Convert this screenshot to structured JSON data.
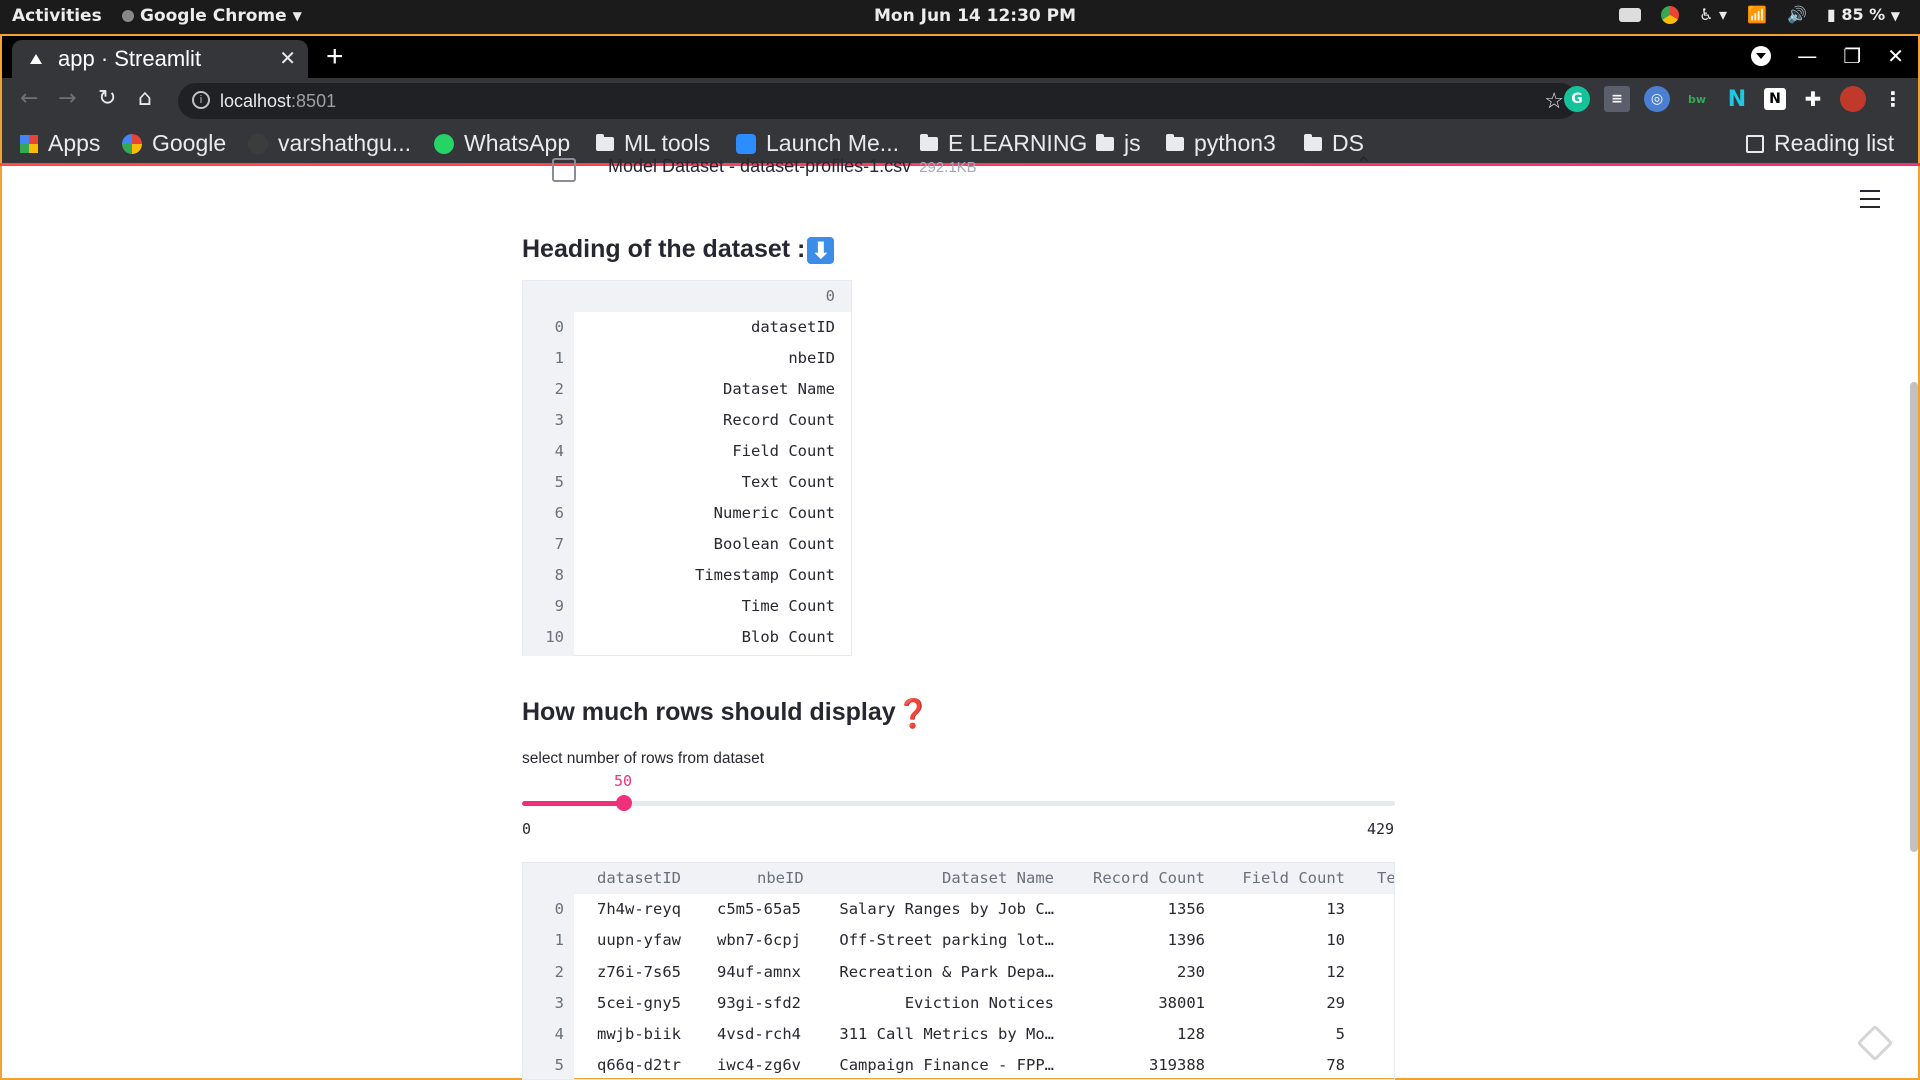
{
  "system_bar": {
    "activities": "Activities",
    "app_menu": "Google Chrome",
    "clock": "Mon Jun 14  12:30 PM",
    "battery": "85 %"
  },
  "browser": {
    "tab_title": "app · Streamlit",
    "url_host": "localhost",
    "url_port": ":8501",
    "bookmarks": [
      "Apps",
      "Google",
      "varshathgu...",
      "WhatsApp",
      "ML tools",
      "Launch Me...",
      "E LEARNING",
      "js",
      "python3",
      "DS"
    ],
    "reading_list": "Reading list"
  },
  "uploader": {
    "file_name": "Model Dataset - dataset-profiles-1.csv",
    "file_size": "292.1KB"
  },
  "heading_section": {
    "title": "Heading of the dataset :",
    "column_header": "0",
    "rows": [
      {
        "i": "0",
        "v": "datasetID"
      },
      {
        "i": "1",
        "v": "nbeID"
      },
      {
        "i": "2",
        "v": "Dataset Name"
      },
      {
        "i": "3",
        "v": "Record Count"
      },
      {
        "i": "4",
        "v": "Field Count"
      },
      {
        "i": "5",
        "v": "Text Count"
      },
      {
        "i": "6",
        "v": "Numeric Count"
      },
      {
        "i": "7",
        "v": "Boolean Count"
      },
      {
        "i": "8",
        "v": "Timestamp Count"
      },
      {
        "i": "9",
        "v": "Time Count"
      },
      {
        "i": "10",
        "v": "Blob Count"
      }
    ]
  },
  "rows_section": {
    "title": "How much rows should display",
    "slider_label": "select number of rows from dataset",
    "slider_value": 50,
    "slider_value_text": "50",
    "slider_min": "0",
    "slider_max": "429",
    "table": {
      "headers": [
        "datasetID",
        "nbeID",
        "Dataset Name",
        "Record Count",
        "Field Count",
        "Te"
      ],
      "rows": [
        {
          "i": "0",
          "datasetID": "7h4w-reyq",
          "nbeID": "c5m5-65a5",
          "name": "Salary Ranges by Job C…",
          "records": "1356",
          "fields": "13"
        },
        {
          "i": "1",
          "datasetID": "uupn-yfaw",
          "nbeID": "wbn7-6cpj",
          "name": "Off-Street parking lot…",
          "records": "1396",
          "fields": "10"
        },
        {
          "i": "2",
          "datasetID": "z76i-7s65",
          "nbeID": "94uf-amnx",
          "name": "Recreation & Park Depa…",
          "records": "230",
          "fields": "12"
        },
        {
          "i": "3",
          "datasetID": "5cei-gny5",
          "nbeID": "93gi-sfd2",
          "name": "Eviction Notices",
          "records": "38001",
          "fields": "29"
        },
        {
          "i": "4",
          "datasetID": "mwjb-biik",
          "nbeID": "4vsd-rch4",
          "name": "311 Call Metrics by Mo…",
          "records": "128",
          "fields": "5"
        },
        {
          "i": "5",
          "datasetID": "q66q-d2tr",
          "nbeID": "iwc4-zg6v",
          "name": "Campaign Finance - FPP…",
          "records": "319388",
          "fields": "78"
        }
      ]
    }
  },
  "colors": {
    "accent": "#f0307a",
    "chrome_dark": "#35363a",
    "frame": "#f3a230"
  }
}
